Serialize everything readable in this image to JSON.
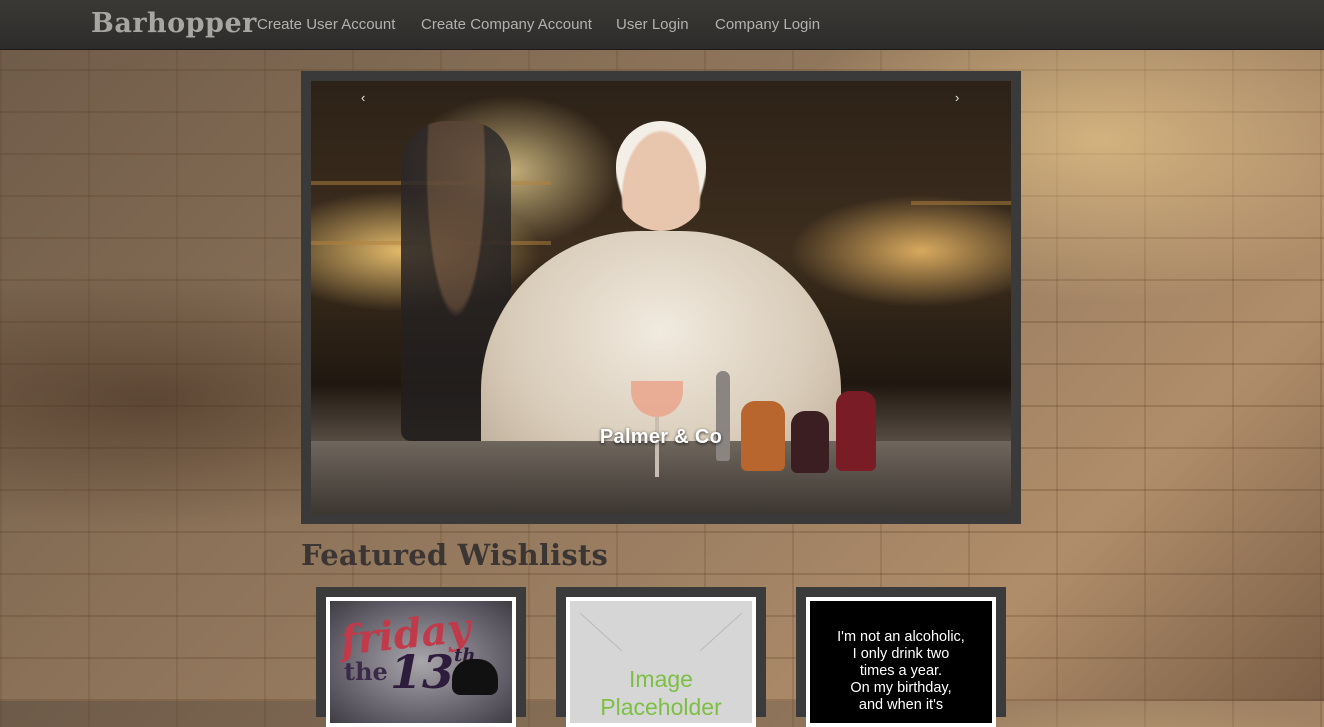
{
  "navbar": {
    "brand": "Barhopper",
    "links": [
      "Create User Account",
      "Create Company Account",
      "User Login",
      "Company Login"
    ]
  },
  "carousel": {
    "prev_label": "‹",
    "next_label": "›",
    "caption": "Palmer & Co"
  },
  "featured": {
    "title": "Featured Wishlists",
    "cards": [
      {
        "image": "friday-the-13th-image",
        "text_friday": "friday",
        "text_the": "the",
        "text_13": "13",
        "text_th": "th"
      },
      {
        "image": "image-placeholder",
        "text": "Image Placeholder"
      },
      {
        "image": "quote-image",
        "text": "I'm not an alcoholic,\nI only drink two\ntimes a year.\nOn my birthday,\nand when it's"
      }
    ]
  },
  "colors": {
    "navbar": "#2e2c2a",
    "frame": "#3a3a3a",
    "placeholder_text": "#7cc043"
  }
}
